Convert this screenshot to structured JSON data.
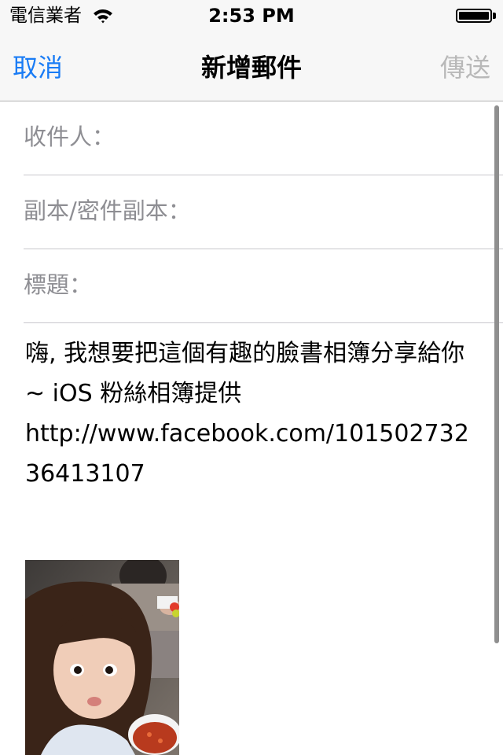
{
  "status_bar": {
    "carrier": "電信業者",
    "time": "2:53 PM"
  },
  "nav": {
    "cancel_label": "取消",
    "title": "新增郵件",
    "send_label": "傳送"
  },
  "fields": {
    "to_label": "收件人：",
    "cc_bcc_label": "副本/密件副本：",
    "subject_label": "標題："
  },
  "body": {
    "text": "嗨, 我想要把這個有趣的臉書相簿分享給你 ~ iOS 粉絲相簿提供\nhttp://www.facebook.com/10150273236413107"
  },
  "attachment": {
    "type": "photo"
  },
  "colors": {
    "accent": "#1a7cf5",
    "disabled": "#b8b8b8",
    "placeholder": "#8e8e93"
  }
}
